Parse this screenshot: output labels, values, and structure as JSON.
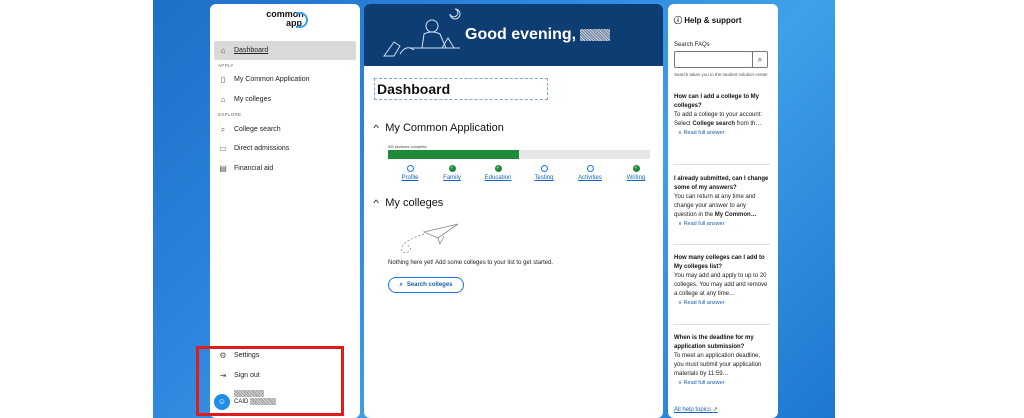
{
  "logo": {
    "line1": "common",
    "line2": "app"
  },
  "sidebar": {
    "dashboard": "Dashboard",
    "apply_label": "APPLY",
    "my_common_app": "My Common Application",
    "my_colleges": "My colleges",
    "explore_label": "EXPLORE",
    "college_search": "College search",
    "direct_admissions": "Direct admissions",
    "financial_aid": "Financial aid",
    "settings": "Settings",
    "sign_out": "Sign out",
    "caid_label": "CAID"
  },
  "main": {
    "greeting": "Good evening,",
    "page_title": "Dashboard",
    "section_app": "My Common Application",
    "progress_text": "3/6 sections complete",
    "progress_fraction": 0.5,
    "steps": [
      {
        "label": "Profile",
        "done": false
      },
      {
        "label": "Family",
        "done": true
      },
      {
        "label": "Education",
        "done": true
      },
      {
        "label": "Testing",
        "done": false
      },
      {
        "label": "Activities",
        "done": false
      },
      {
        "label": "Writing",
        "done": true
      }
    ],
    "section_colleges": "My colleges",
    "empty_text": "Nothing here yet! Add some colleges to your list to get started.",
    "search_button": "Search colleges"
  },
  "help": {
    "title": "Help & support",
    "search_label": "Search FAQs",
    "search_hint": "Search takes you to the student solution center",
    "read_more": "Read full answer",
    "faqs": [
      {
        "q": "How can I add a college to My colleges?",
        "a1": "To add a college to your account:",
        "a2pre": "Select ",
        "a2bold": "College search",
        "a2post": " from th…"
      },
      {
        "q": "I already submitted, can I change some of my answers?",
        "a1": "You can return at any time and change your answer to any question in the ",
        "a2bold": "My Common…"
      },
      {
        "q": "How many colleges can I add to My colleges list?",
        "a1": "You may add and apply to up to 20 colleges. You may add and remove a college at any time…"
      },
      {
        "q": "When is the deadline for my application submission?",
        "a1": "To meet an application deadline, you must submit your application materials by 11:59…"
      }
    ],
    "all_topics": "All help topics"
  },
  "colors": {
    "accent": "#1a73e8",
    "banner": "#0e3d73",
    "progress": "#1e8a3a",
    "highlight": "#e01b1b"
  }
}
